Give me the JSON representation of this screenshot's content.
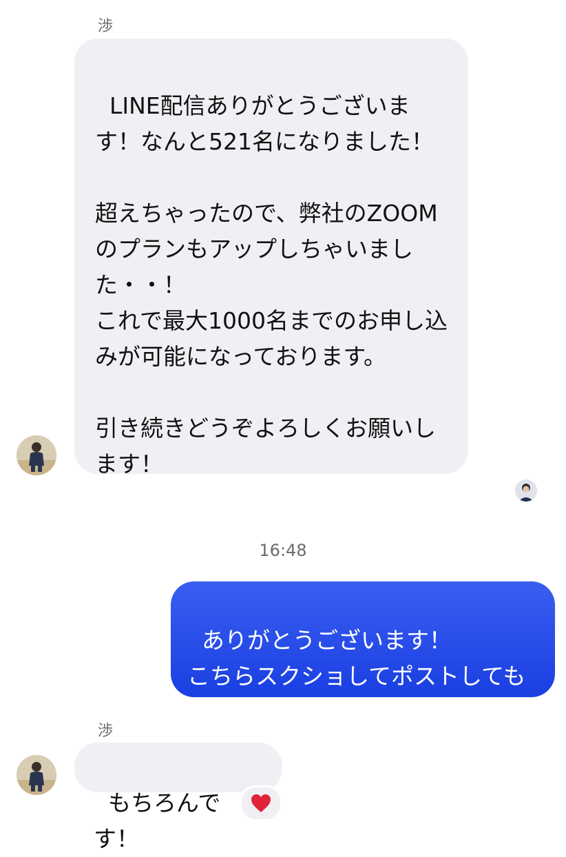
{
  "messages": [
    {
      "sender": "渉",
      "text": "LINE配信ありがとうございます！なんと521名になりました！\n\n超えちゃったので、弊社のZOOMのプランもアップしちゃいました・・！\nこれで最大1000名までのお申し込みが可能になっております。\n\n引き続きどうぞよろしくお願いします！"
    },
    {
      "timestamp": "16:48"
    },
    {
      "text": "ありがとうございます！\nこちらスクショしてポストしてもよろしいでしょうか！"
    },
    {
      "sender": "渉",
      "text": "もちろんです！",
      "reaction": "heart"
    }
  ],
  "colors": {
    "incoming_bubble": "#f0f0f4",
    "outgoing_bubble": "#2348e8",
    "reaction_heart": "#e0243a"
  },
  "icons": {
    "reaction": "heart-icon",
    "avatar": "profile-photo-avatar"
  }
}
